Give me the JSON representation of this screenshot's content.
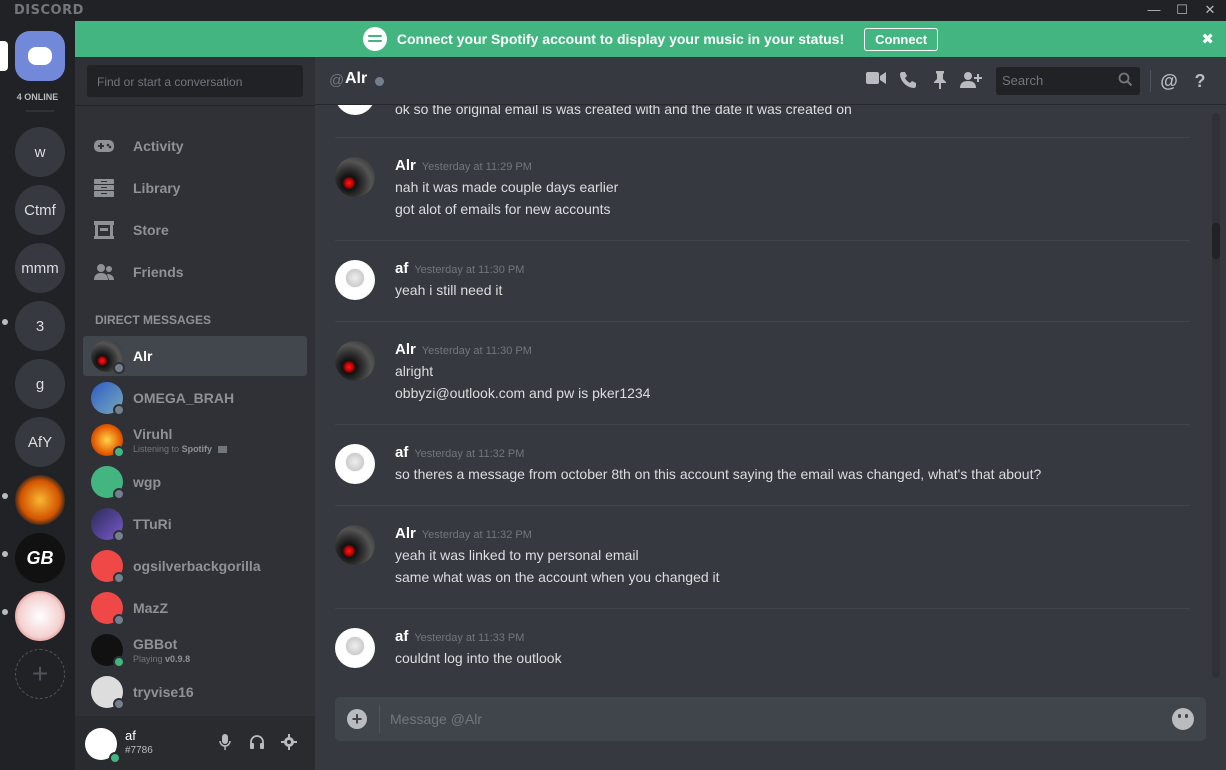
{
  "window": {
    "brand": "DISCORD",
    "minimize": "—",
    "maximize": "☐",
    "close": "✕"
  },
  "banner": {
    "text": "Connect your Spotify account to display your music in your status!",
    "button": "Connect",
    "close": "✖"
  },
  "guilds": {
    "online_label": "4 ONLINE",
    "items": [
      {
        "label": "w"
      },
      {
        "label": "Ctmf"
      },
      {
        "label": "mmm"
      },
      {
        "label": "3"
      },
      {
        "label": "g"
      },
      {
        "label": "AfY"
      },
      {
        "label": ""
      },
      {
        "label": "GB"
      },
      {
        "label": ""
      }
    ],
    "add_label": "+"
  },
  "sidebar": {
    "search_placeholder": "Find or start a conversation",
    "nav": [
      {
        "label": "Activity",
        "icon": "gamepad-icon"
      },
      {
        "label": "Library",
        "icon": "library-icon"
      },
      {
        "label": "Store",
        "icon": "store-icon"
      },
      {
        "label": "Friends",
        "icon": "friends-icon"
      }
    ],
    "dm_header": "DIRECT MESSAGES",
    "dms": [
      {
        "name": "Alr",
        "status": "offline",
        "active": true
      },
      {
        "name": "OMEGA_BRAH",
        "status": "offline"
      },
      {
        "name": "Viruhl",
        "status": "online",
        "sub_prefix": "Listening to",
        "sub_bold": "Spotify"
      },
      {
        "name": "wgp",
        "status": "offline"
      },
      {
        "name": "TTuRi",
        "status": "offline"
      },
      {
        "name": "ogsilverbackgorilla",
        "status": "offline"
      },
      {
        "name": "MazZ",
        "status": "offline"
      },
      {
        "name": "GBBot",
        "status": "online",
        "sub_prefix": "Playing",
        "sub_bold": "v0.9.8"
      },
      {
        "name": "tryvise16",
        "status": "offline"
      }
    ],
    "user": {
      "name": "af",
      "tag": "#7786"
    }
  },
  "chat": {
    "at": "@",
    "name": "Alr",
    "search_placeholder": "Search",
    "composer_placeholder": "Message @Alr",
    "messages": [
      {
        "author": "",
        "time": "",
        "lines": [
          "ok so the original email is was created with and the date it was created on"
        ]
      },
      {
        "author": "Alr",
        "time": "Yesterday at 11:29 PM",
        "lines": [
          "nah it was made couple days earlier",
          "got alot of emails for new accounts"
        ]
      },
      {
        "author": "af",
        "time": "Yesterday at 11:30 PM",
        "lines": [
          "yeah i still need it"
        ]
      },
      {
        "author": "Alr",
        "time": "Yesterday at 11:30 PM",
        "lines": [
          "alright",
          "obbyzi@outlook.com and pw is pker1234"
        ]
      },
      {
        "author": "af",
        "time": "Yesterday at 11:32 PM",
        "lines": [
          "so theres a message from october 8th on this account saying the email was changed, what's that about?"
        ]
      },
      {
        "author": "Alr",
        "time": "Yesterday at 11:32 PM",
        "lines": [
          "yeah it was linked to my personal email",
          "same what was on the account when you changed it"
        ]
      },
      {
        "author": "af",
        "time": "Yesterday at 11:33 PM",
        "lines": [
          "couldnt log into the outlook"
        ]
      }
    ]
  },
  "colors": {
    "banner": "#43b581",
    "blurple": "#7289da",
    "online": "#43b581",
    "offline": "#747f8d"
  }
}
